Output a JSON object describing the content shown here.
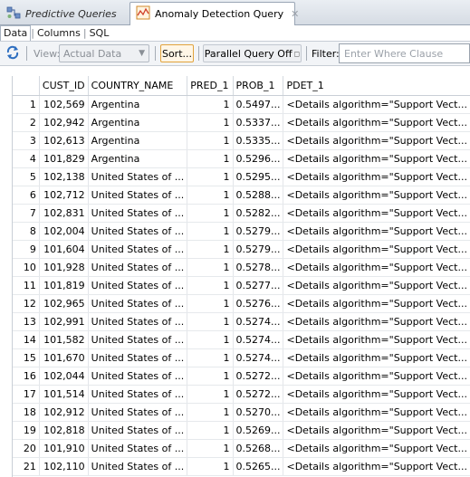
{
  "tabs": [
    {
      "label": "Predictive Queries",
      "icon": "network-query-icon"
    },
    {
      "label": "Anomaly Detection Query",
      "icon": "chart-query-icon",
      "close": "✕"
    }
  ],
  "subtabs": [
    "Data",
    "Columns",
    "SQL"
  ],
  "toolbar": {
    "view_label": "View:",
    "view_value": "Actual Data",
    "sort_label": "Sort...",
    "parallel_label": "Parallel Query Off",
    "filter_label": "Filter:",
    "where_placeholder": "Enter Where Clause"
  },
  "table": {
    "headers": [
      "",
      "CUST_ID",
      "COUNTRY_NAME",
      "PRED_1",
      "PROB_1",
      "PDET_1"
    ],
    "rows": [
      [
        "1",
        "102,569",
        "Argentina",
        "1",
        "0.5497...",
        "<Details algorithm=\"Support Vect..."
      ],
      [
        "2",
        "102,942",
        "Argentina",
        "1",
        "0.5337...",
        "<Details algorithm=\"Support Vect..."
      ],
      [
        "3",
        "102,613",
        "Argentina",
        "1",
        "0.5335...",
        "<Details algorithm=\"Support Vect..."
      ],
      [
        "4",
        "101,829",
        "Argentina",
        "1",
        "0.5296...",
        "<Details algorithm=\"Support Vect..."
      ],
      [
        "5",
        "102,138",
        "United States of ...",
        "1",
        "0.5295...",
        "<Details algorithm=\"Support Vect..."
      ],
      [
        "6",
        "102,712",
        "United States of ...",
        "1",
        "0.5288...",
        "<Details algorithm=\"Support Vect..."
      ],
      [
        "7",
        "102,831",
        "United States of ...",
        "1",
        "0.5282...",
        "<Details algorithm=\"Support Vect..."
      ],
      [
        "8",
        "102,004",
        "United States of ...",
        "1",
        "0.5279...",
        "<Details algorithm=\"Support Vect..."
      ],
      [
        "9",
        "101,604",
        "United States of ...",
        "1",
        "0.5279...",
        "<Details algorithm=\"Support Vect..."
      ],
      [
        "10",
        "101,928",
        "United States of ...",
        "1",
        "0.5278...",
        "<Details algorithm=\"Support Vect..."
      ],
      [
        "11",
        "101,819",
        "United States of ...",
        "1",
        "0.5277...",
        "<Details algorithm=\"Support Vect..."
      ],
      [
        "12",
        "102,965",
        "United States of ...",
        "1",
        "0.5276...",
        "<Details algorithm=\"Support Vect..."
      ],
      [
        "13",
        "102,991",
        "United States of ...",
        "1",
        "0.5274...",
        "<Details algorithm=\"Support Vect..."
      ],
      [
        "14",
        "101,582",
        "United States of ...",
        "1",
        "0.5274...",
        "<Details algorithm=\"Support Vect..."
      ],
      [
        "15",
        "101,670",
        "United States of ...",
        "1",
        "0.5274...",
        "<Details algorithm=\"Support Vect..."
      ],
      [
        "16",
        "102,044",
        "United States of ...",
        "1",
        "0.5272...",
        "<Details algorithm=\"Support Vect..."
      ],
      [
        "17",
        "101,514",
        "United States of ...",
        "1",
        "0.5272...",
        "<Details algorithm=\"Support Vect..."
      ],
      [
        "18",
        "102,912",
        "United States of ...",
        "1",
        "0.5270...",
        "<Details algorithm=\"Support Vect..."
      ],
      [
        "19",
        "102,818",
        "United States of ...",
        "1",
        "0.5269...",
        "<Details algorithm=\"Support Vect..."
      ],
      [
        "20",
        "101,910",
        "United States of ...",
        "1",
        "0.5268...",
        "<Details algorithm=\"Support Vect..."
      ],
      [
        "21",
        "102,110",
        "United States of ...",
        "1",
        "0.5265...",
        "<Details algorithm=\"Support Vect..."
      ]
    ]
  },
  "colors": {
    "accent": "#e1a33c",
    "tab_bg": "#d6dce4",
    "grid_line": "#e3e6ea"
  }
}
